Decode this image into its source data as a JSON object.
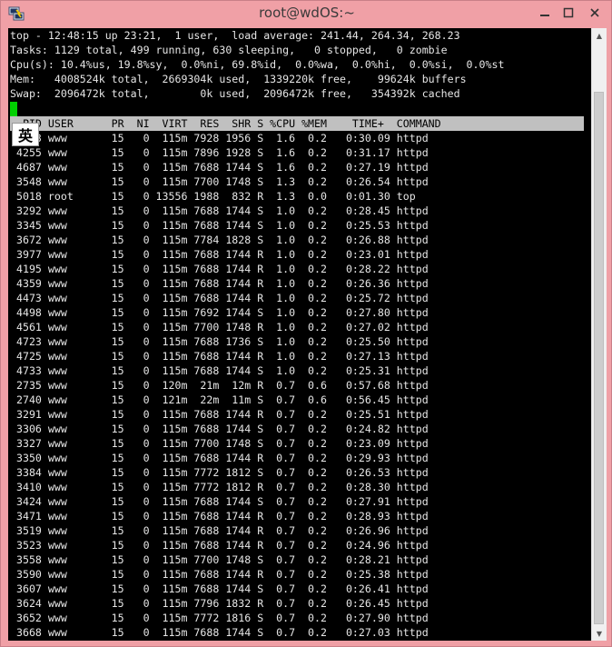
{
  "window": {
    "title": "root@wdOS:~",
    "minimize_glyph": "−",
    "maximize_glyph": "□",
    "close_glyph": "✕",
    "icon": "putty-icon"
  },
  "ime": {
    "label": "英"
  },
  "summary": [
    "top - 12:48:15 up 23:21,  1 user,  load average: 241.44, 264.34, 268.23",
    "Tasks: 1129 total, 499 running, 630 sleeping,   0 stopped,   0 zombie",
    "Cpu(s): 10.4%us, 19.8%sy,  0.0%ni, 69.8%id,  0.0%wa,  0.0%hi,  0.0%si,  0.0%st",
    "Mem:   4008524k total,  2669304k used,  1339220k free,    99624k buffers",
    "Swap:  2096472k total,        0k used,  2096472k free,   354392k cached"
  ],
  "header": "  PID USER      PR  NI  VIRT  RES  SHR S %CPU %MEM    TIME+  COMMAND",
  "processes": [
    "    3 www       15   0  115m 7928 1956 S  1.6  0.2   0:30.09 httpd",
    " 4255 www       15   0  115m 7896 1928 S  1.6  0.2   0:31.17 httpd",
    " 4687 www       15   0  115m 7688 1744 S  1.6  0.2   0:27.19 httpd",
    " 3548 www       15   0  115m 7700 1748 S  1.3  0.2   0:26.54 httpd",
    " 5018 root      15   0 13556 1988  832 R  1.3  0.0   0:01.30 top",
    " 3292 www       15   0  115m 7688 1744 S  1.0  0.2   0:28.45 httpd",
    " 3345 www       15   0  115m 7688 1744 S  1.0  0.2   0:25.53 httpd",
    " 3672 www       15   0  115m 7784 1828 S  1.0  0.2   0:26.88 httpd",
    " 3977 www       15   0  115m 7688 1744 R  1.0  0.2   0:23.01 httpd",
    " 4195 www       15   0  115m 7688 1744 R  1.0  0.2   0:28.22 httpd",
    " 4359 www       15   0  115m 7688 1744 R  1.0  0.2   0:26.36 httpd",
    " 4473 www       15   0  115m 7688 1744 R  1.0  0.2   0:25.72 httpd",
    " 4498 www       15   0  115m 7692 1744 S  1.0  0.2   0:27.80 httpd",
    " 4561 www       15   0  115m 7700 1748 R  1.0  0.2   0:27.02 httpd",
    " 4723 www       15   0  115m 7688 1736 S  1.0  0.2   0:25.50 httpd",
    " 4725 www       15   0  115m 7688 1744 R  1.0  0.2   0:27.13 httpd",
    " 4733 www       15   0  115m 7688 1744 S  1.0  0.2   0:25.31 httpd",
    " 2735 www       15   0  120m  21m  12m R  0.7  0.6   0:57.68 httpd",
    " 2740 www       15   0  121m  22m  11m S  0.7  0.6   0:56.45 httpd",
    " 3291 www       15   0  115m 7688 1744 R  0.7  0.2   0:25.51 httpd",
    " 3306 www       15   0  115m 7688 1744 S  0.7  0.2   0:24.82 httpd",
    " 3327 www       15   0  115m 7700 1748 S  0.7  0.2   0:23.09 httpd",
    " 3350 www       15   0  115m 7688 1744 R  0.7  0.2   0:29.93 httpd",
    " 3384 www       15   0  115m 7772 1812 S  0.7  0.2   0:26.53 httpd",
    " 3410 www       15   0  115m 7772 1812 R  0.7  0.2   0:28.30 httpd",
    " 3424 www       15   0  115m 7688 1744 S  0.7  0.2   0:27.91 httpd",
    " 3471 www       15   0  115m 7688 1744 R  0.7  0.2   0:28.93 httpd",
    " 3519 www       15   0  115m 7688 1744 R  0.7  0.2   0:26.96 httpd",
    " 3523 www       15   0  115m 7688 1744 R  0.7  0.2   0:24.96 httpd",
    " 3558 www       15   0  115m 7700 1748 S  0.7  0.2   0:28.21 httpd",
    " 3590 www       15   0  115m 7688 1744 R  0.7  0.2   0:25.38 httpd",
    " 3607 www       15   0  115m 7688 1744 S  0.7  0.2   0:26.41 httpd",
    " 3624 www       15   0  115m 7796 1832 R  0.7  0.2   0:26.45 httpd",
    " 3652 www       15   0  115m 7772 1816 S  0.7  0.2   0:27.90 httpd",
    " 3668 www       15   0  115m 7688 1744 S  0.7  0.2   0:27.03 httpd"
  ]
}
